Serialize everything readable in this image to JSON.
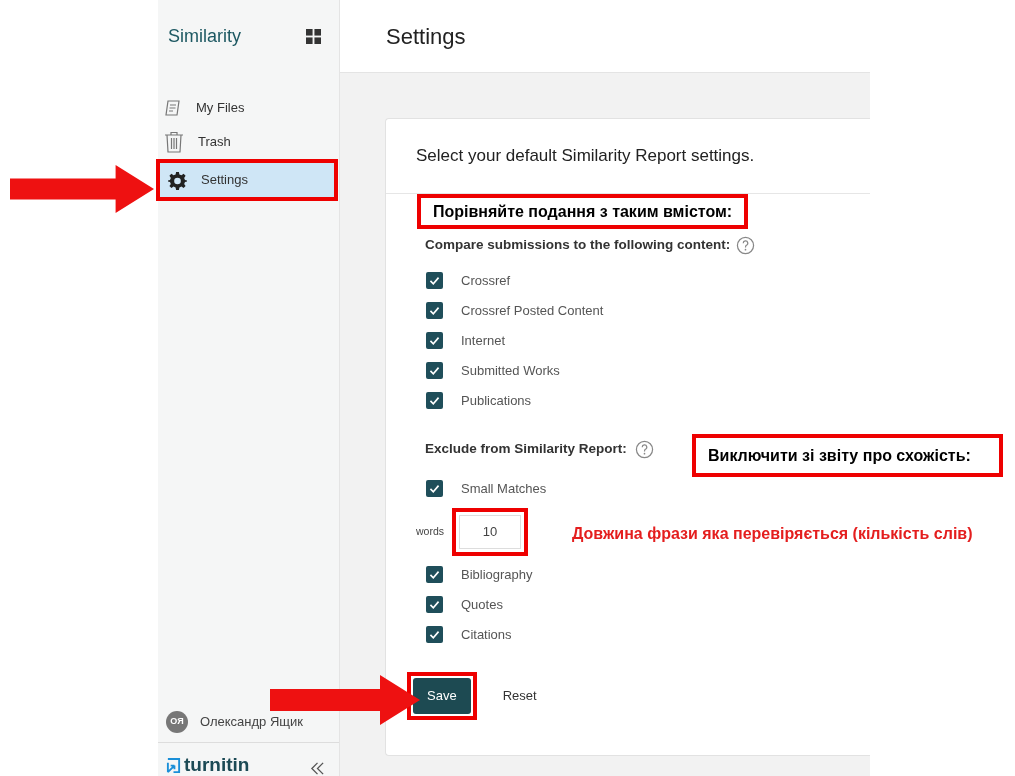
{
  "sidebar": {
    "title": "Similarity",
    "items": [
      {
        "label": "My Files",
        "selected": false,
        "highlighted": false,
        "arrow": false
      },
      {
        "label": "Trash",
        "selected": false,
        "highlighted": false,
        "arrow": false
      },
      {
        "label": "Settings",
        "selected": true,
        "highlighted": true,
        "arrow": true
      }
    ],
    "user": {
      "initials": "ОЯ",
      "name": "Олександр Ящик"
    },
    "logo": "turnitin"
  },
  "header": {
    "title": "Settings"
  },
  "card": {
    "heading": "Select your default Similarity Report settings.",
    "compare": {
      "label": "Compare submissions to the following content:",
      "options": [
        {
          "label": "Crossref",
          "checked": true
        },
        {
          "label": "Crossref Posted Content",
          "checked": true
        },
        {
          "label": "Internet",
          "checked": true
        },
        {
          "label": "Submitted Works",
          "checked": true
        },
        {
          "label": "Publications",
          "checked": true
        }
      ]
    },
    "exclude": {
      "label": "Exclude from Similarity Report:",
      "options": [
        {
          "label": "Small Matches",
          "checked": true,
          "kind": "words"
        },
        {
          "label": "Bibliography",
          "checked": true
        },
        {
          "label": "Quotes",
          "checked": true
        },
        {
          "label": "Citations",
          "checked": true
        }
      ],
      "words_label": "words",
      "words_value": "10",
      "words_highlighted": true
    },
    "buttons": [
      {
        "label": "Save",
        "kind": "primary",
        "highlighted": true,
        "arrow": true
      },
      {
        "label": "Reset",
        "kind": "link",
        "highlighted": false,
        "arrow": false
      }
    ]
  },
  "annotations": [
    {
      "text": "Порівняйте подання з таким вмістом:",
      "kind": "boxed"
    },
    {
      "text": "Виключити зі звіту про схожість:",
      "kind": "boxed"
    },
    {
      "text": "Довжина фрази яка перевіряється (кількість слів)",
      "kind": "red"
    }
  ]
}
